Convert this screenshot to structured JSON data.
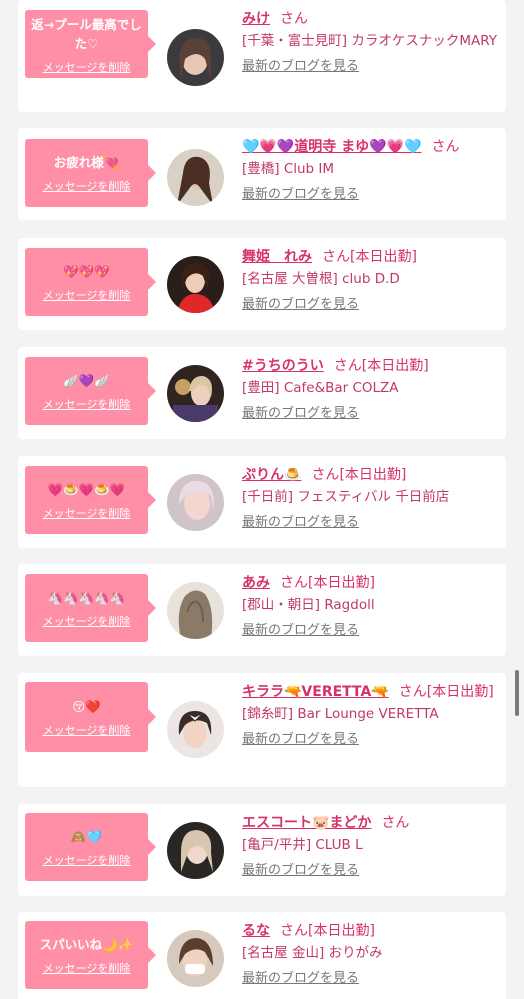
{
  "cards": [
    {
      "message": "返→プール最高でした♡",
      "delete_label": "メッセージを削除",
      "name": "みけ",
      "san": "さん",
      "status": "",
      "shop": "[千葉・富士見町] カラオケスナックMARY",
      "blog": "最新のブログを見る"
    },
    {
      "message": "お疲れ様💘",
      "delete_label": "メッセージを削除",
      "name": "🩵💗💜道明寺 まゆ💜💗🩵",
      "san": "さん",
      "status": "",
      "shop": "[豊橋] Club IM",
      "blog": "最新のブログを見る"
    },
    {
      "message": "💖💖💖",
      "delete_label": "メッセージを削除",
      "name": "舞姫　れみ",
      "san": "さん",
      "status": "[本日出勤]",
      "shop": "[名古屋 大曽根] club D.D",
      "blog": "最新のブログを見る"
    },
    {
      "message": "🪽💜🪽",
      "delete_label": "メッセージを削除",
      "name": "#うちのうい",
      "san": "さん",
      "status": "[本日出勤]",
      "shop": "[豊田] Cafe&Bar COLZA",
      "blog": "最新のブログを見る"
    },
    {
      "message": "💗🍮💗🍮💗",
      "delete_label": "メッセージを削除",
      "name": "ぷりん🍮",
      "san": "さん",
      "status": "[本日出勤]",
      "shop": "[千日前] フェスティバル 千日前店",
      "blog": "最新のブログを見る"
    },
    {
      "message": "🦄🦄🦄🦄🦄",
      "delete_label": "メッセージを削除",
      "name": "あみ",
      "san": "さん",
      "status": "[本日出勤]",
      "shop": "[郡山・朝日] Ragdoll",
      "blog": "最新のブログを見る"
    },
    {
      "message": "😚❤️",
      "delete_label": "メッセージを削除",
      "name": "キララ🔫VERETTA🔫",
      "san": "さん",
      "status": "[本日出勤]",
      "shop": "[錦糸町] Bar Lounge VERETTA",
      "blog": "最新のブログを見る"
    },
    {
      "message": "🙈🩵",
      "delete_label": "メッセージを削除",
      "name": "エスコート🐷まどか",
      "san": "さん",
      "status": "",
      "shop": "[亀戸/平井] CLUB L",
      "blog": "最新のブログを見る"
    },
    {
      "message": "スパいいね🌙✨",
      "delete_label": "メッセージを削除",
      "name": "るな",
      "san": "さん",
      "status": "[本日出勤]",
      "shop": "[名古屋 金山] おりがみ",
      "blog": "最新のブログを見る"
    }
  ],
  "colors": {
    "bubble": "#ff8fa7",
    "name": "#d7306a",
    "background": "#f3f3f3"
  }
}
